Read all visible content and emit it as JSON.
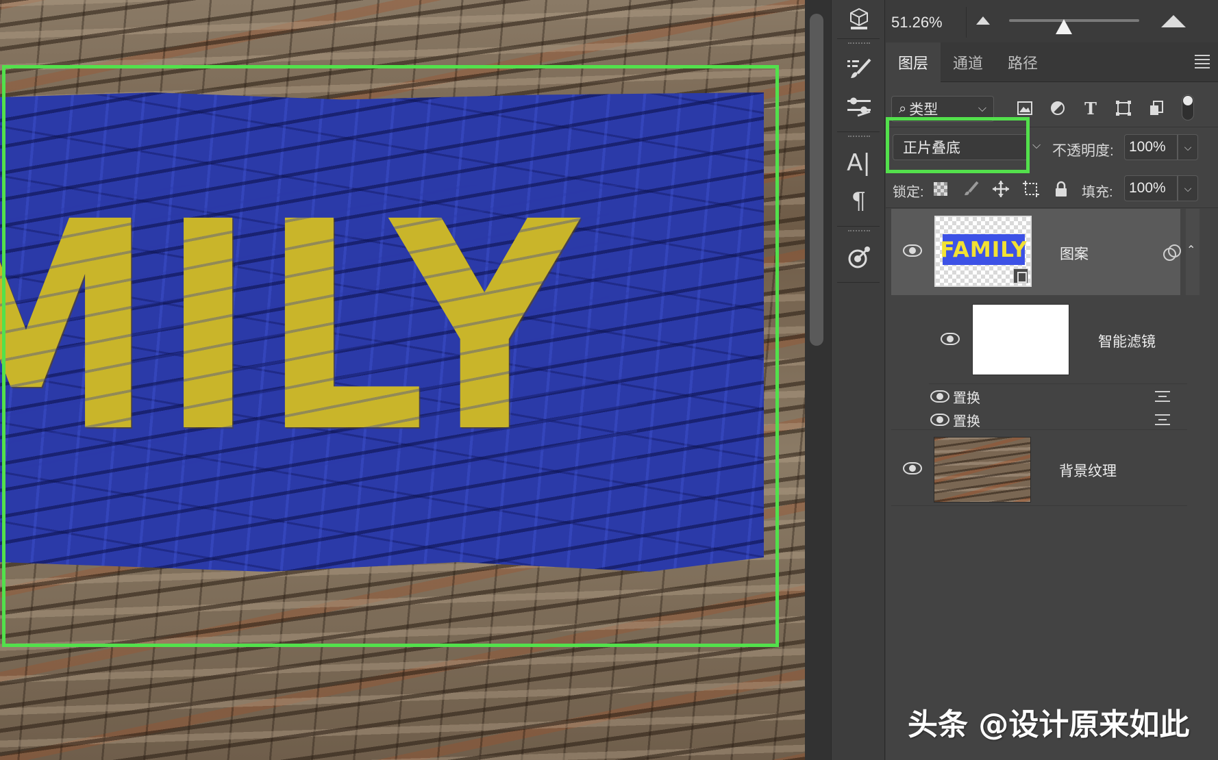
{
  "canvas": {
    "artwork_text": "MILY"
  },
  "toolbar": {
    "tools": [
      "3d-icon",
      "brush-settings-icon",
      "adjustments-icon",
      "character-icon",
      "paragraph-icon",
      "graph-select-icon"
    ]
  },
  "zoom": {
    "value": "51.26%",
    "slider_level": 0.42
  },
  "panel": {
    "tabs": [
      "图层",
      "通道",
      "路径"
    ],
    "active_tab": "图层"
  },
  "filter": {
    "kind_label": "类型",
    "icons": [
      "image-filter-icon",
      "adjustment-filter-icon",
      "type-filter-icon",
      "shape-filter-icon",
      "smart-object-filter-icon"
    ]
  },
  "blend": {
    "mode": "正片叠底",
    "opacity_label": "不透明度:",
    "opacity_value": "100%"
  },
  "lock": {
    "label": "锁定:",
    "fill_label": "填充:",
    "fill_value": "100%"
  },
  "layers": {
    "pattern": {
      "name": "图案",
      "thumb_text": "FAMILY"
    },
    "smart_filters": {
      "name": "智能滤镜",
      "items": [
        "置换",
        "置换"
      ]
    },
    "background": {
      "name": "背景纹理"
    }
  },
  "watermark": "头条 @设计原来如此",
  "colors": {
    "highlight_green": "#53e04c",
    "banner_blue": "#2b3aa8",
    "text_yellow": "#c9b52a"
  }
}
